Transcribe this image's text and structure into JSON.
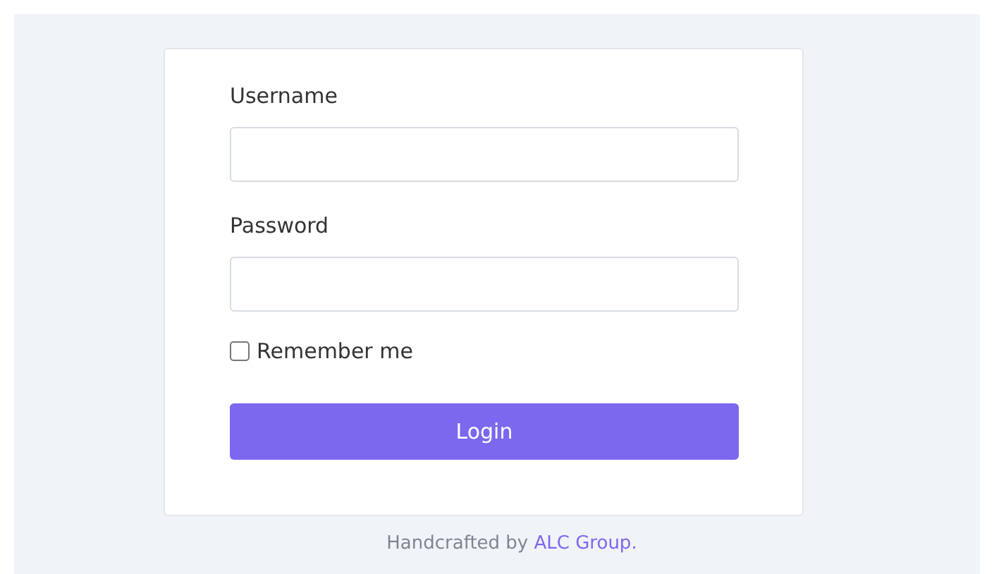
{
  "form": {
    "fields": [
      {
        "label": "Username"
      },
      {
        "label": "Password"
      }
    ],
    "remember": {
      "label": "Remember me",
      "checked": false
    },
    "button": "Login"
  },
  "footer": {
    "text": "Handcrafted by",
    "link": "ALC Group."
  }
}
